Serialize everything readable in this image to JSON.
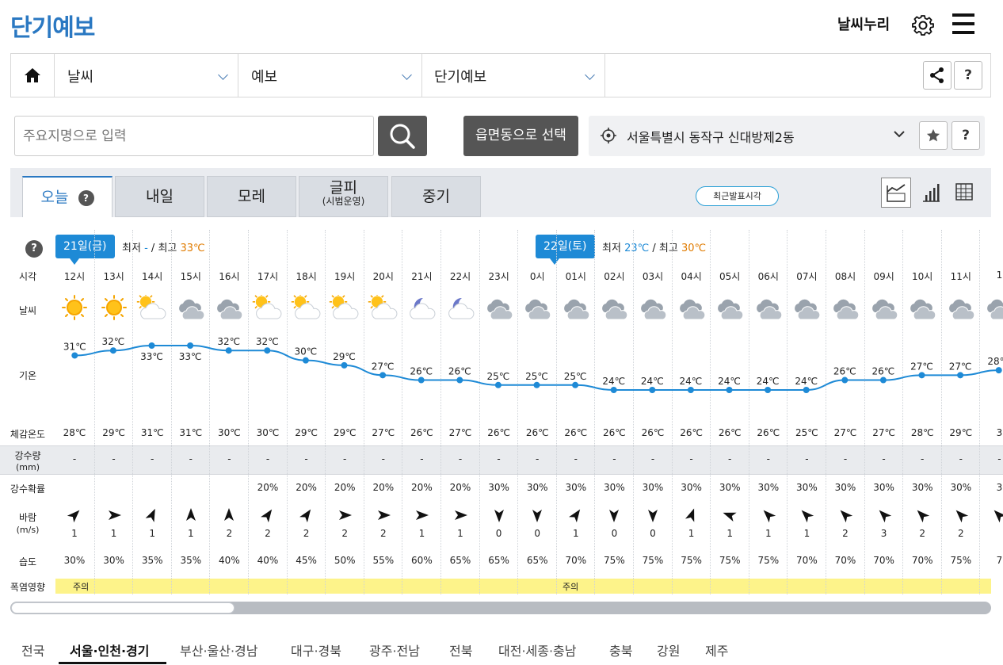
{
  "header": {
    "title": "단기예보",
    "brand": "날씨누리"
  },
  "nav": {
    "level1": "날씨",
    "level2": "예보",
    "level3": "단기예보",
    "help": "?"
  },
  "search": {
    "placeholder": "주요지명으로 입력",
    "town_button": "읍면동으로 선택",
    "location": "서울특별시 동작구 신대방제2동",
    "help": "?"
  },
  "tabs": [
    {
      "label": "오늘",
      "sub": ""
    },
    {
      "label": "내일",
      "sub": ""
    },
    {
      "label": "모레",
      "sub": ""
    },
    {
      "label": "글피",
      "sub": "(시범운영)"
    },
    {
      "label": "중기",
      "sub": ""
    }
  ],
  "tab_help": "?",
  "recent_button": "최근발표시각",
  "forecast": {
    "help": "?",
    "day1": {
      "badge": "21일(금)",
      "min_label": "최저",
      "min": "-",
      "sep": "/",
      "max_label": "최고",
      "max": "33℃"
    },
    "day2": {
      "badge": "22일(토)",
      "min_label": "최저",
      "min": "23℃",
      "sep": "/",
      "max_label": "최고",
      "max": "30℃"
    },
    "row_labels": {
      "time": "시각",
      "weather": "날씨",
      "temp": "기온",
      "feels": "체감온도",
      "rain_l1": "강수량",
      "rain_l2": "(mm)",
      "prob": "강수확률",
      "wind_l1": "바람",
      "wind_l2": "(m/s)",
      "humid": "습도",
      "heat": "폭염영향"
    },
    "heat_labels": [
      "주의",
      "주의"
    ],
    "hours": [
      {
        "time": "12시",
        "icon": "sun",
        "temp": 31,
        "feels": "28℃",
        "rain": "-",
        "prob": "",
        "wind_dir": 225,
        "wind": "1",
        "humid": "30%"
      },
      {
        "time": "13시",
        "icon": "sun",
        "temp": 32,
        "feels": "29℃",
        "rain": "-",
        "prob": "",
        "wind_dir": 270,
        "wind": "1",
        "humid": "30%"
      },
      {
        "time": "14시",
        "icon": "sun-cloud",
        "temp": 33,
        "feels": "31℃",
        "rain": "-",
        "prob": "",
        "wind_dir": 205,
        "wind": "1",
        "humid": "35%"
      },
      {
        "time": "15시",
        "icon": "cloud",
        "temp": 33,
        "feels": "31℃",
        "rain": "-",
        "prob": "",
        "wind_dir": 180,
        "wind": "1",
        "humid": "35%"
      },
      {
        "time": "16시",
        "icon": "cloud",
        "temp": 32,
        "feels": "30℃",
        "rain": "-",
        "prob": "",
        "wind_dir": 180,
        "wind": "2",
        "humid": "40%"
      },
      {
        "time": "17시",
        "icon": "sun-cloud",
        "temp": 32,
        "feels": "30℃",
        "rain": "-",
        "prob": "20%",
        "wind_dir": 215,
        "wind": "2",
        "humid": "40%"
      },
      {
        "time": "18시",
        "icon": "sun-cloud",
        "temp": 30,
        "feels": "29℃",
        "rain": "-",
        "prob": "20%",
        "wind_dir": 215,
        "wind": "2",
        "humid": "45%"
      },
      {
        "time": "19시",
        "icon": "sun-cloud",
        "temp": 29,
        "feels": "29℃",
        "rain": "-",
        "prob": "20%",
        "wind_dir": 270,
        "wind": "2",
        "humid": "50%"
      },
      {
        "time": "20시",
        "icon": "sun-cloud",
        "temp": 27,
        "feels": "27℃",
        "rain": "-",
        "prob": "20%",
        "wind_dir": 270,
        "wind": "2",
        "humid": "55%"
      },
      {
        "time": "21시",
        "icon": "moon-cloud",
        "temp": 26,
        "feels": "26℃",
        "rain": "-",
        "prob": "20%",
        "wind_dir": 270,
        "wind": "1",
        "humid": "60%"
      },
      {
        "time": "22시",
        "icon": "moon-cloud",
        "temp": 26,
        "feels": "27℃",
        "rain": "-",
        "prob": "20%",
        "wind_dir": 270,
        "wind": "1",
        "humid": "65%"
      },
      {
        "time": "23시",
        "icon": "cloud",
        "temp": 25,
        "feels": "26℃",
        "rain": "-",
        "prob": "30%",
        "wind_dir": 0,
        "wind": "0",
        "humid": "65%"
      },
      {
        "time": "0시",
        "icon": "cloud",
        "temp": 25,
        "feels": "26℃",
        "rain": "-",
        "prob": "30%",
        "wind_dir": 0,
        "wind": "0",
        "humid": "65%"
      },
      {
        "time": "01시",
        "icon": "cloud",
        "temp": 25,
        "feels": "26℃",
        "rain": "-",
        "prob": "30%",
        "wind_dir": 215,
        "wind": "1",
        "humid": "70%"
      },
      {
        "time": "02시",
        "icon": "cloud",
        "temp": 24,
        "feels": "26℃",
        "rain": "-",
        "prob": "30%",
        "wind_dir": 0,
        "wind": "0",
        "humid": "75%"
      },
      {
        "time": "03시",
        "icon": "cloud",
        "temp": 24,
        "feels": "26℃",
        "rain": "-",
        "prob": "30%",
        "wind_dir": 0,
        "wind": "0",
        "humid": "75%"
      },
      {
        "time": "04시",
        "icon": "cloud",
        "temp": 24,
        "feels": "26℃",
        "rain": "-",
        "prob": "30%",
        "wind_dir": 200,
        "wind": "1",
        "humid": "75%"
      },
      {
        "time": "05시",
        "icon": "cloud",
        "temp": 24,
        "feels": "26℃",
        "rain": "-",
        "prob": "30%",
        "wind_dir": 110,
        "wind": "1",
        "humid": "75%"
      },
      {
        "time": "06시",
        "icon": "cloud",
        "temp": 24,
        "feels": "26℃",
        "rain": "-",
        "prob": "30%",
        "wind_dir": 135,
        "wind": "1",
        "humid": "75%"
      },
      {
        "time": "07시",
        "icon": "cloud",
        "temp": 24,
        "feels": "25℃",
        "rain": "-",
        "prob": "30%",
        "wind_dir": 135,
        "wind": "1",
        "humid": "70%"
      },
      {
        "time": "08시",
        "icon": "cloud",
        "temp": 26,
        "feels": "27℃",
        "rain": "-",
        "prob": "30%",
        "wind_dir": 135,
        "wind": "2",
        "humid": "70%"
      },
      {
        "time": "09시",
        "icon": "cloud",
        "temp": 26,
        "feels": "27℃",
        "rain": "-",
        "prob": "30%",
        "wind_dir": 135,
        "wind": "3",
        "humid": "70%"
      },
      {
        "time": "10시",
        "icon": "cloud",
        "temp": 27,
        "feels": "28℃",
        "rain": "-",
        "prob": "30%",
        "wind_dir": 135,
        "wind": "2",
        "humid": "70%"
      },
      {
        "time": "11시",
        "icon": "cloud",
        "temp": 27,
        "feels": "29℃",
        "rain": "-",
        "prob": "30%",
        "wind_dir": 135,
        "wind": "2",
        "humid": "75%"
      },
      {
        "time": "1",
        "icon": "cloud",
        "temp": 28,
        "feels": "3",
        "rain": "-",
        "prob": "3",
        "wind_dir": 135,
        "wind": "",
        "humid": "7"
      }
    ]
  },
  "regions": [
    "전국",
    "서울·인천·경기",
    "부산·울산·경남",
    "대구·경북",
    "광주·전남",
    "전북",
    "대전·세종·충남",
    "충북",
    "강원",
    "제주"
  ],
  "colors": {
    "accent": "#2a78c2",
    "badge": "#1e8ad6",
    "line": "#1e8ad6",
    "max_temp": "#e07b00",
    "heat": "#fdf38a"
  }
}
